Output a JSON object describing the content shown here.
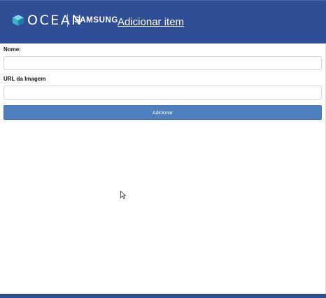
{
  "header": {
    "brand": "OCEAN",
    "partner": "SAMSUNG",
    "page_link": "Adicionar item",
    "background_color": "#2f4e96",
    "logo_icon": "cube-logo-icon"
  },
  "form": {
    "name_label": "Nome:",
    "name_value": "",
    "image_url_label": "URL da Imagem",
    "image_url_value": "",
    "submit_label": "Adicionar",
    "button_color": "#4e7fbf"
  },
  "footer": {
    "color": "#2f4e96"
  }
}
